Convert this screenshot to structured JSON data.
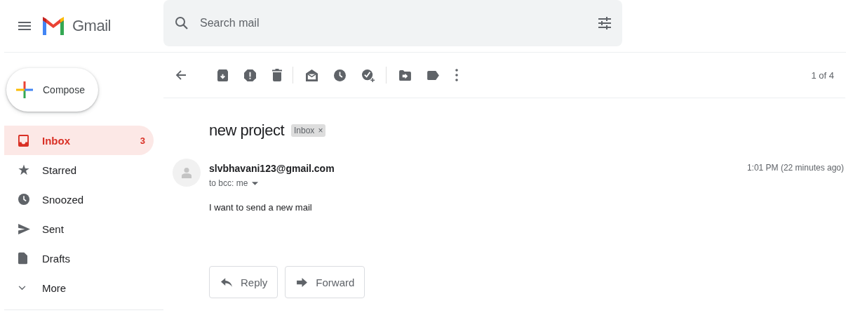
{
  "header": {
    "app_name": "Gmail",
    "search": {
      "placeholder": "Search mail"
    }
  },
  "compose": {
    "label": "Compose"
  },
  "sidebar": {
    "items": [
      {
        "label": "Inbox",
        "count": "3",
        "selected": true
      },
      {
        "label": "Starred",
        "selected": false
      },
      {
        "label": "Snoozed",
        "selected": false
      },
      {
        "label": "Sent",
        "selected": false
      },
      {
        "label": "Drafts",
        "selected": false
      },
      {
        "label": "More",
        "selected": false
      }
    ]
  },
  "toolbar": {
    "pager": "1 of 4"
  },
  "message": {
    "subject": "new project",
    "label_chip": "Inbox",
    "chip_close": "×",
    "sender": "slvbhavani123@gmail.com",
    "recipients": "to bcc: me",
    "time": "1:01 PM (22 minutes ago)",
    "body": "I want to send a new mail"
  },
  "actions": [
    {
      "label": "Reply"
    },
    {
      "label": "Forward"
    }
  ]
}
